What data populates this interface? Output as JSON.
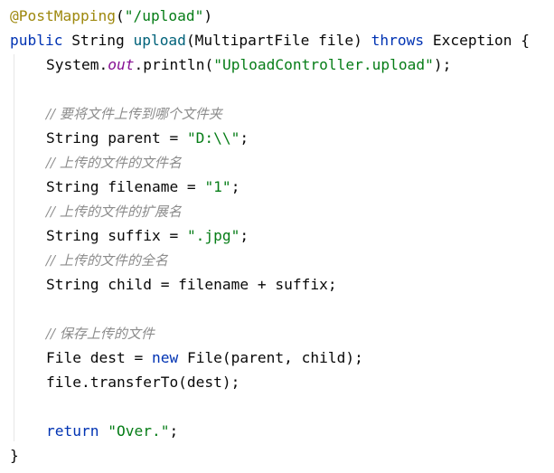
{
  "code": {
    "annotation": "@PostMapping",
    "mapping_open": "(",
    "mapping_path": "\"/upload\"",
    "mapping_close": ")",
    "kw_public": "public",
    "ret_type": " String ",
    "method_name": "upload",
    "params": "(MultipartFile file) ",
    "kw_throws": "throws",
    "exception": " Exception {",
    "print_prefix": "System.",
    "print_field": "out",
    "print_call": ".println(",
    "print_arg": "\"UploadController.upload\"",
    "print_end": ");",
    "comment_parent": "// 要将文件上传到哪个文件夹",
    "parent_decl": "String parent = ",
    "parent_value": "\"D:\\\\\"",
    "semicolon": ";",
    "comment_filename": "// 上传的文件的文件名",
    "filename_decl": "String filename = ",
    "filename_value": "\"1\"",
    "comment_suffix": "// 上传的文件的扩展名",
    "suffix_decl": "String suffix = ",
    "suffix_value": "\".jpg\"",
    "comment_child": "// 上传的文件的全名",
    "child_line": "String child = filename + suffix;",
    "comment_save": "// 保存上传的文件",
    "dest_decl": "File dest = ",
    "kw_new": "new",
    "dest_ctor": " File(parent, child);",
    "transfer_line": "file.transferTo(dest);",
    "kw_return": "return",
    "return_value": " \"Over.\"",
    "closing_brace": "}"
  }
}
